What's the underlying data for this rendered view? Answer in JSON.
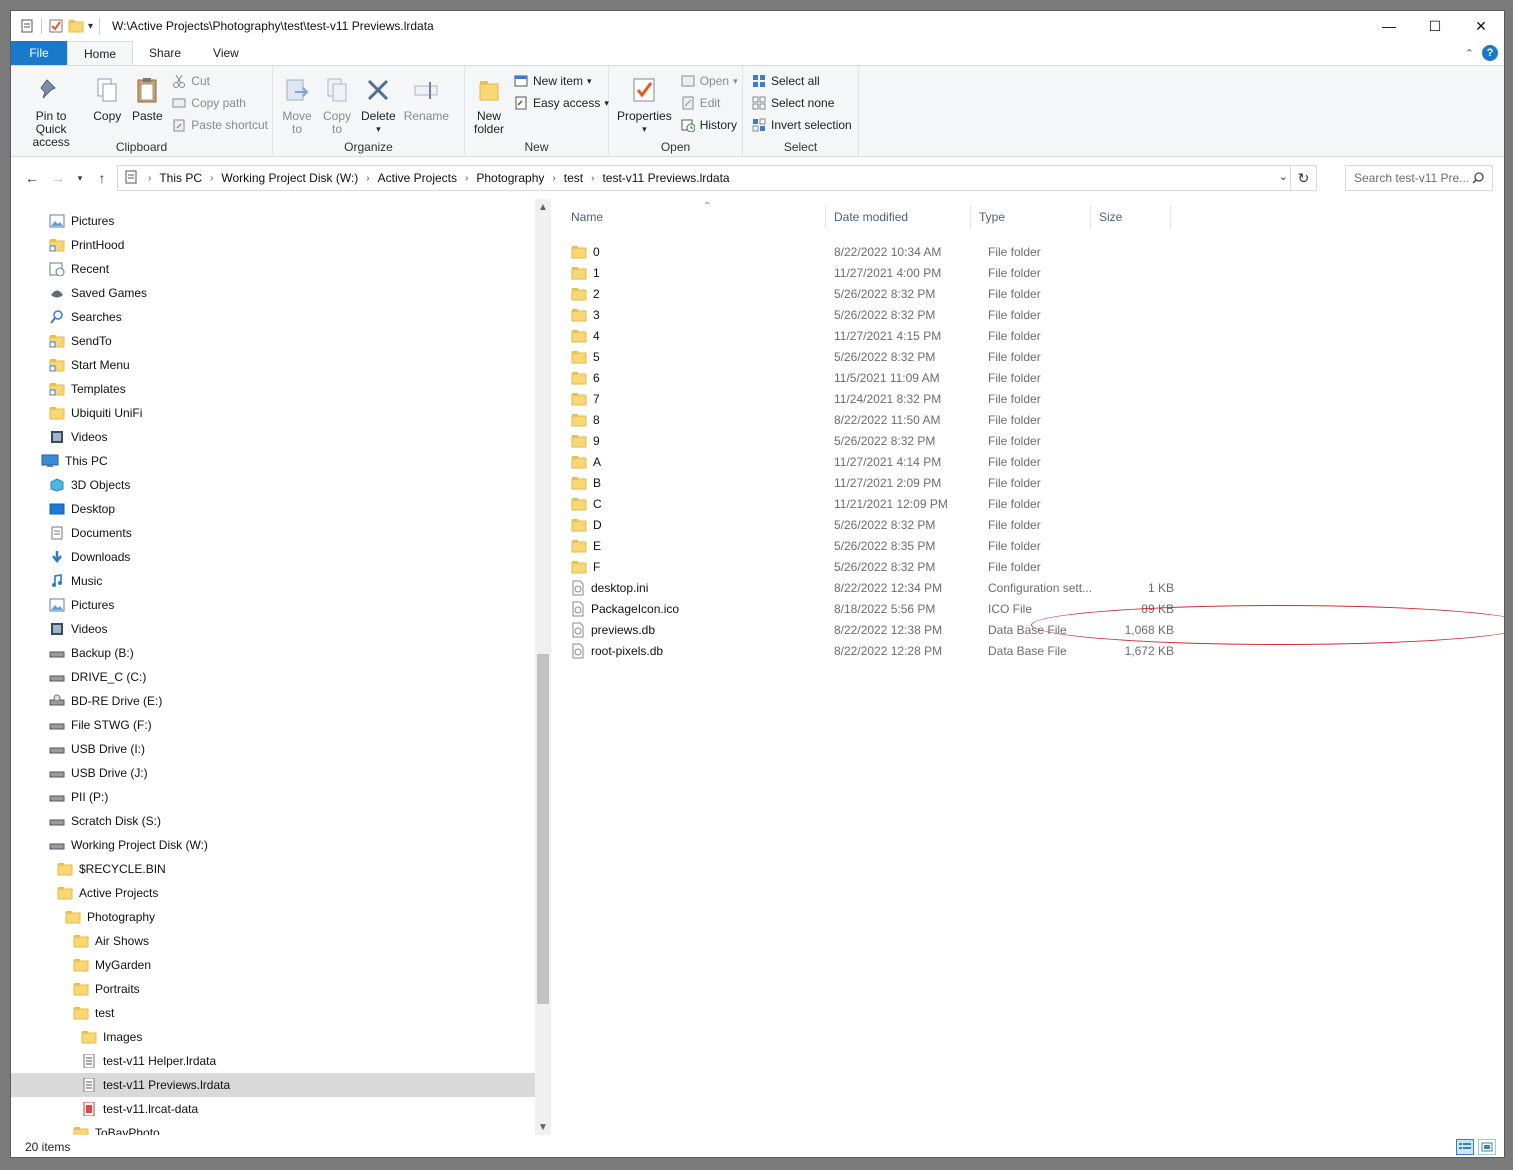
{
  "window": {
    "title": "W:\\Active Projects\\Photography\\test\\test-v11 Previews.lrdata"
  },
  "tabs": {
    "file": "File",
    "home": "Home",
    "share": "Share",
    "view": "View"
  },
  "ribbon": {
    "clipboard": {
      "label": "Clipboard",
      "pin_line1": "Pin to Quick",
      "pin_line2": "access",
      "copy": "Copy",
      "paste": "Paste",
      "cut": "Cut",
      "copy_path": "Copy path",
      "paste_shortcut": "Paste shortcut"
    },
    "organize": {
      "label": "Organize",
      "move_line1": "Move",
      "move_line2": "to",
      "copy_line1": "Copy",
      "copy_line2": "to",
      "delete": "Delete",
      "rename": "Rename"
    },
    "new": {
      "label": "New",
      "new_folder_line1": "New",
      "new_folder_line2": "folder",
      "new_item": "New item",
      "easy_access": "Easy access"
    },
    "open": {
      "label": "Open",
      "properties": "Properties",
      "open": "Open",
      "edit": "Edit",
      "history": "History"
    },
    "select": {
      "label": "Select",
      "select_all": "Select all",
      "select_none": "Select none",
      "invert": "Invert selection"
    }
  },
  "address": {
    "crumbs": [
      "This PC",
      "Working Project Disk (W:)",
      "Active Projects",
      "Photography",
      "test",
      "test-v11 Previews.lrdata"
    ]
  },
  "search": {
    "placeholder": "Search test-v11 Pre..."
  },
  "nav_items": [
    {
      "label": "Pictures",
      "icon": "pictures-icon"
    },
    {
      "label": "PrintHood",
      "icon": "folder-shortcut-icon"
    },
    {
      "label": "Recent",
      "icon": "recent-icon"
    },
    {
      "label": "Saved Games",
      "icon": "saved-games-icon"
    },
    {
      "label": "Searches",
      "icon": "search-icon"
    },
    {
      "label": "SendTo",
      "icon": "folder-shortcut-icon"
    },
    {
      "label": "Start Menu",
      "icon": "folder-shortcut-icon"
    },
    {
      "label": "Templates",
      "icon": "folder-shortcut-icon"
    },
    {
      "label": "Ubiquiti UniFi",
      "icon": "folder-icon"
    },
    {
      "label": "Videos",
      "icon": "videos-icon"
    },
    {
      "label": "This PC",
      "icon": "computer-icon"
    },
    {
      "label": "3D Objects",
      "icon": "3d-objects-icon"
    },
    {
      "label": "Desktop",
      "icon": "desktop-icon"
    },
    {
      "label": "Documents",
      "icon": "documents-icon"
    },
    {
      "label": "Downloads",
      "icon": "downloads-icon"
    },
    {
      "label": "Music",
      "icon": "music-icon"
    },
    {
      "label": "Pictures",
      "icon": "pictures-icon"
    },
    {
      "label": "Videos",
      "icon": "videos-icon"
    },
    {
      "label": "Backup (B:)",
      "icon": "drive-icon"
    },
    {
      "label": "DRIVE_C (C:)",
      "icon": "drive-icon"
    },
    {
      "label": "BD-RE Drive (E:)",
      "icon": "optical-drive-icon"
    },
    {
      "label": "File STWG (F:)",
      "icon": "drive-icon"
    },
    {
      "label": "USB Drive (I:)",
      "icon": "drive-icon"
    },
    {
      "label": "USB Drive (J:)",
      "icon": "drive-icon"
    },
    {
      "label": "PII (P:)",
      "icon": "drive-icon"
    },
    {
      "label": "Scratch Disk (S:)",
      "icon": "drive-icon"
    },
    {
      "label": "Working Project Disk (W:)",
      "icon": "drive-icon"
    },
    {
      "label": "$RECYCLE.BIN",
      "icon": "folder-icon"
    },
    {
      "label": "Active Projects",
      "icon": "folder-icon"
    },
    {
      "label": "Photography",
      "icon": "folder-icon"
    },
    {
      "label": "Air Shows",
      "icon": "folder-icon"
    },
    {
      "label": "MyGarden",
      "icon": "folder-icon"
    },
    {
      "label": "Portraits",
      "icon": "folder-icon"
    },
    {
      "label": "test",
      "icon": "folder-icon"
    },
    {
      "label": "Images",
      "icon": "folder-icon"
    },
    {
      "label": "test-v11 Helper.lrdata",
      "icon": "document-icon"
    },
    {
      "label": "test-v11 Previews.lrdata",
      "icon": "document-icon"
    },
    {
      "label": "test-v11.lrcat-data",
      "icon": "lrcat-icon"
    },
    {
      "label": "ToBayPhoto",
      "icon": "folder-icon"
    }
  ],
  "columns": {
    "name": "Name",
    "date": "Date modified",
    "type": "Type",
    "size": "Size"
  },
  "files": [
    {
      "name": "0",
      "date": "8/22/2022 10:34 AM",
      "type": "File folder",
      "size": "",
      "kind": "folder"
    },
    {
      "name": "1",
      "date": "11/27/2021 4:00 PM",
      "type": "File folder",
      "size": "",
      "kind": "folder"
    },
    {
      "name": "2",
      "date": "5/26/2022 8:32 PM",
      "type": "File folder",
      "size": "",
      "kind": "folder"
    },
    {
      "name": "3",
      "date": "5/26/2022 8:32 PM",
      "type": "File folder",
      "size": "",
      "kind": "folder"
    },
    {
      "name": "4",
      "date": "11/27/2021 4:15 PM",
      "type": "File folder",
      "size": "",
      "kind": "folder"
    },
    {
      "name": "5",
      "date": "5/26/2022 8:32 PM",
      "type": "File folder",
      "size": "",
      "kind": "folder"
    },
    {
      "name": "6",
      "date": "11/5/2021 11:09 AM",
      "type": "File folder",
      "size": "",
      "kind": "folder"
    },
    {
      "name": "7",
      "date": "11/24/2021 8:32 PM",
      "type": "File folder",
      "size": "",
      "kind": "folder"
    },
    {
      "name": "8",
      "date": "8/22/2022 11:50 AM",
      "type": "File folder",
      "size": "",
      "kind": "folder"
    },
    {
      "name": "9",
      "date": "5/26/2022 8:32 PM",
      "type": "File folder",
      "size": "",
      "kind": "folder"
    },
    {
      "name": "A",
      "date": "11/27/2021 4:14 PM",
      "type": "File folder",
      "size": "",
      "kind": "folder"
    },
    {
      "name": "B",
      "date": "11/27/2021 2:09 PM",
      "type": "File folder",
      "size": "",
      "kind": "folder"
    },
    {
      "name": "C",
      "date": "11/21/2021 12:09 PM",
      "type": "File folder",
      "size": "",
      "kind": "folder"
    },
    {
      "name": "D",
      "date": "5/26/2022 8:32 PM",
      "type": "File folder",
      "size": "",
      "kind": "folder"
    },
    {
      "name": "E",
      "date": "5/26/2022 8:35 PM",
      "type": "File folder",
      "size": "",
      "kind": "folder"
    },
    {
      "name": "F",
      "date": "5/26/2022 8:32 PM",
      "type": "File folder",
      "size": "",
      "kind": "folder"
    },
    {
      "name": "desktop.ini",
      "date": "8/22/2022 12:34 PM",
      "type": "Configuration sett...",
      "size": "1 KB",
      "kind": "file"
    },
    {
      "name": "PackageIcon.ico",
      "date": "8/18/2022 5:56 PM",
      "type": "ICO File",
      "size": "89 KB",
      "kind": "file"
    },
    {
      "name": "previews.db",
      "date": "8/22/2022 12:38 PM",
      "type": "Data Base File",
      "size": "1,068 KB",
      "kind": "file"
    },
    {
      "name": "root-pixels.db",
      "date": "8/22/2022 12:28 PM",
      "type": "Data Base File",
      "size": "1,672 KB",
      "kind": "file"
    }
  ],
  "status": {
    "count": "20 items"
  },
  "colors": {
    "accent": "#1979ca",
    "folder": "#f8d775",
    "annotation": "#c8323a",
    "selection": "#d9d9d9"
  }
}
